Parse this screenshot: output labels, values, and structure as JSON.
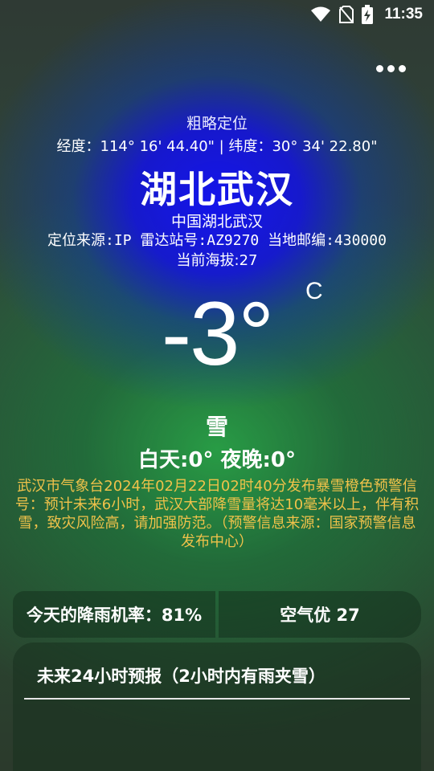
{
  "status_bar": {
    "time": "11:35",
    "icons": [
      "wifi-icon",
      "no-sim-icon",
      "battery-charging-icon"
    ]
  },
  "menu": {
    "icon": "more-horizontal-icon"
  },
  "location": {
    "mode": "粗略定位",
    "coords": "经度：114° 16' 44.40\" | 纬度：30° 34' 22.80\"",
    "city": "湖北武汉",
    "region": "中国湖北武汉",
    "meta": "定位来源:IP  雷达站号:AZ9270  当地邮编:430000",
    "altitude": "当前海拔:27"
  },
  "weather": {
    "temperature": "-3°",
    "unit": "C",
    "condition": "雪",
    "day_night": "白天:0°  夜晚:0°"
  },
  "warning": {
    "text": "武汉市气象台2024年02月22日02时40分发布暴雪橙色预警信号：预计未来6小时，武汉大部降雪量将达10毫米以上，伴有积雪，致灾风险高，请加强防范。（预警信息来源：国家预警信息发布中心）",
    "color": "#f0c24a"
  },
  "cards": {
    "rain": "今天的降雨机率：81%",
    "air": "空气优 27"
  },
  "forecast": {
    "title": "未来24小时预报（2小时内有雨夹雪）"
  }
}
